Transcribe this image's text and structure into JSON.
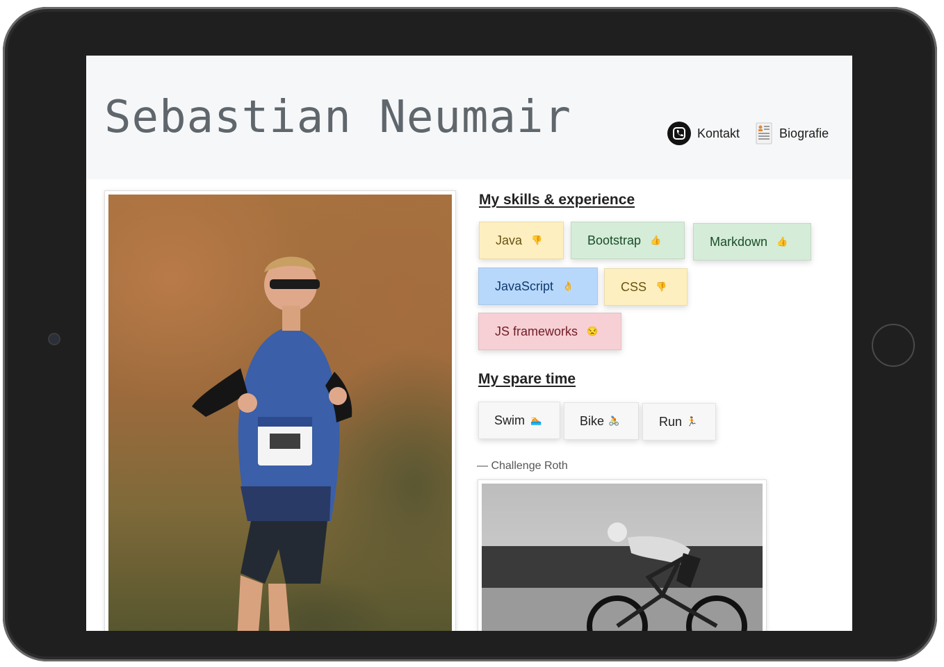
{
  "header": {
    "site_title": "Sebastian Neumair",
    "nav": [
      {
        "label": "Kontakt",
        "icon": "phone-icon"
      },
      {
        "label": "Biografie",
        "icon": "document-icon"
      }
    ]
  },
  "skills": {
    "title": "My skills & experience",
    "items": [
      {
        "label": "Java",
        "emoji": "👎",
        "color": "#fdefc0"
      },
      {
        "label": "Bootstrap",
        "emoji": "👍",
        "color": "#d4ecd8"
      },
      {
        "label": "Markdown",
        "emoji": "👍",
        "color": "#d4ecd8"
      },
      {
        "label": "JavaScript",
        "emoji": "👌",
        "color": "#b8d8fb"
      },
      {
        "label": "CSS",
        "emoji": "👎",
        "color": "#fdefc0"
      },
      {
        "label": "JS frameworks",
        "emoji": "😒",
        "color": "#f6d0d4"
      }
    ]
  },
  "spare_time": {
    "title": "My spare time",
    "items": [
      {
        "label": "Swim",
        "emoji": "🏊"
      },
      {
        "label": "Bike",
        "emoji": "🚴"
      },
      {
        "label": "Run",
        "emoji": "🏃"
      }
    ]
  },
  "caption": "— Challenge Roth"
}
